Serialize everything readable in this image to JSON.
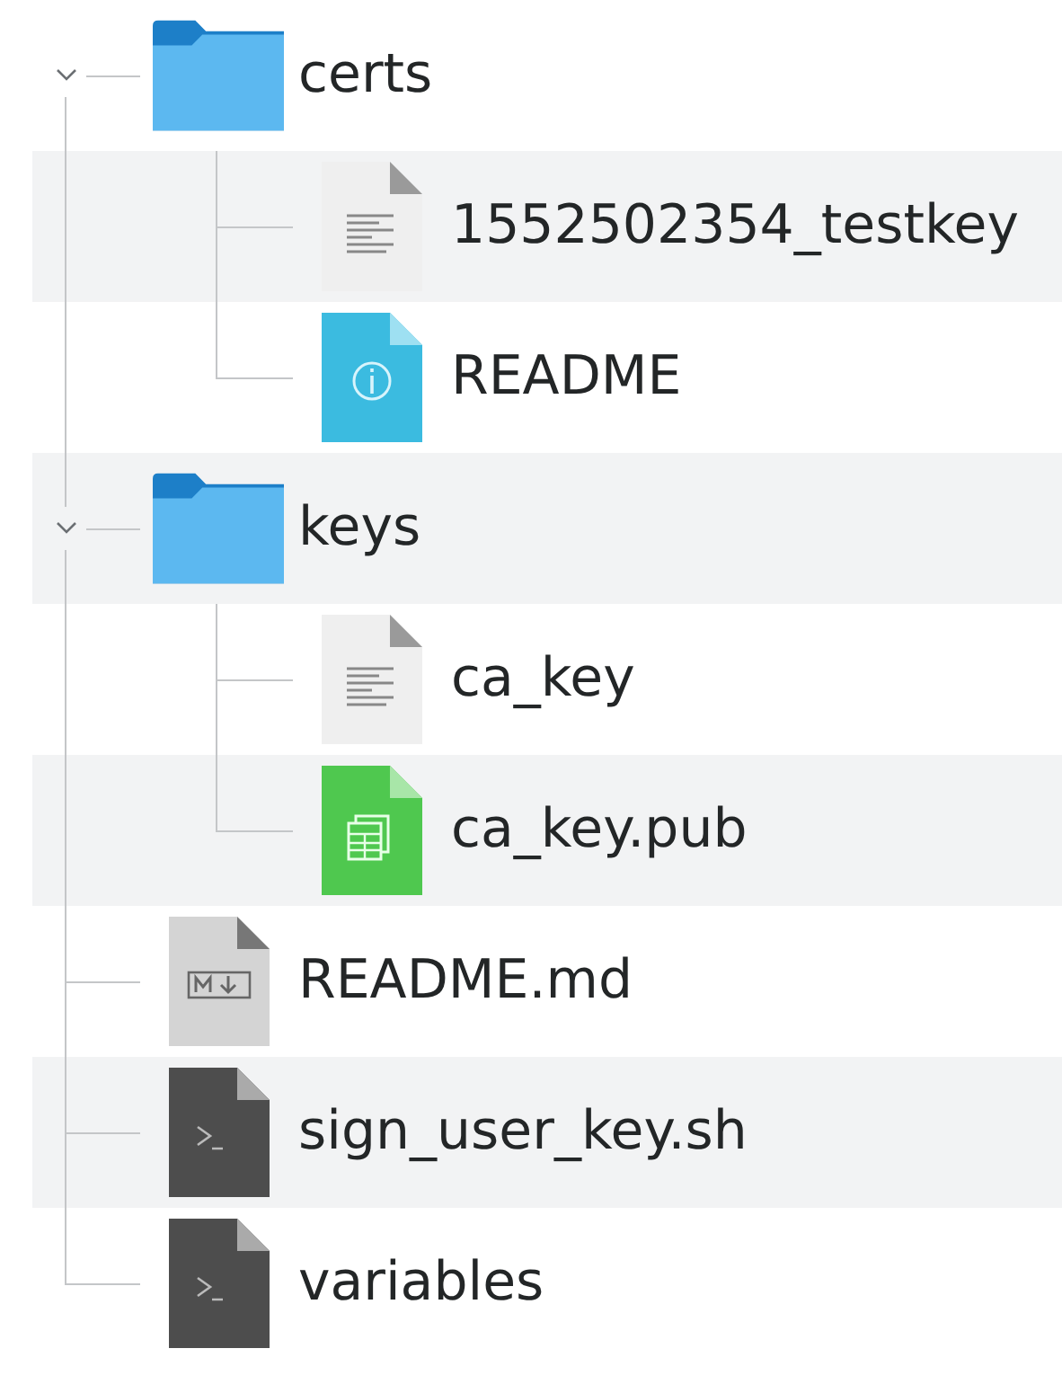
{
  "tree": [
    {
      "name": "certs",
      "kind": "folder",
      "expanded": true,
      "children": [
        {
          "name": "1552502354_testkey",
          "kind": "text"
        },
        {
          "name": "README",
          "kind": "info"
        }
      ]
    },
    {
      "name": "keys",
      "kind": "folder",
      "expanded": true,
      "children": [
        {
          "name": "ca_key",
          "kind": "text"
        },
        {
          "name": "ca_key.pub",
          "kind": "spreadsheet"
        }
      ]
    },
    {
      "name": "README.md",
      "kind": "markdown"
    },
    {
      "name": "sign_user_key.sh",
      "kind": "script"
    },
    {
      "name": "variables",
      "kind": "script"
    }
  ]
}
